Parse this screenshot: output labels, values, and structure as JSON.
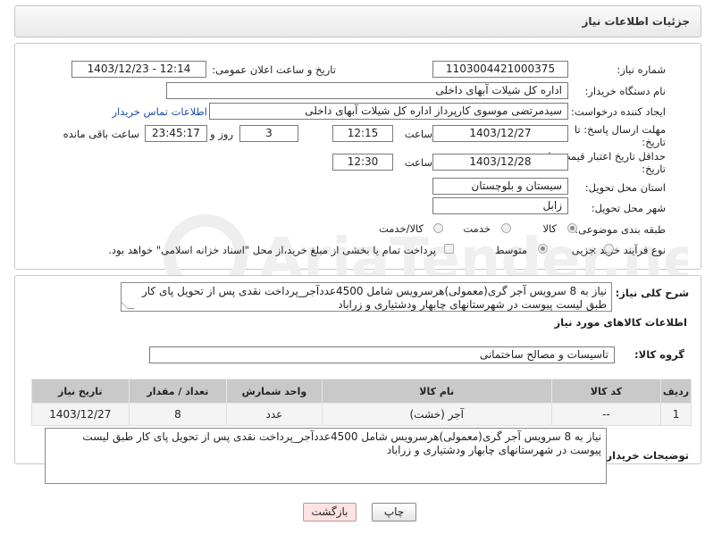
{
  "header": {
    "title": "جزئیات اطلاعات نیاز"
  },
  "fields": {
    "need_number_label": "شماره نیاز:",
    "need_number": "1103004421000375",
    "announce_label": "تاریخ و ساعت اعلان عمومی:",
    "announce_value": "1403/12/23 - 12:14",
    "buyer_org_label": "نام دستگاه خریدار:",
    "buyer_org": "اداره کل شیلات آبهای داخلی",
    "requester_label": "ایجاد کننده درخواست:",
    "requester": "سیدمرتضی موسوی کارپرداز اداره کل شیلات آبهای داخلی",
    "contact_link": "اطلاعات تماس خریدار",
    "deadline_label_1": "مهلت ارسال پاسخ: تا",
    "deadline_label_2": "تاریخ:",
    "deadline_date": "1403/12/27",
    "time_label": "ساعت",
    "deadline_time": "12:15",
    "days_count": "3",
    "days_label": "روز و",
    "remaining_time": "23:45:17",
    "remaining_label": "ساعت باقی مانده",
    "validity_label_1": "حداقل تاریخ اعتبار قیمت: تا",
    "validity_label_2": "تاریخ:",
    "validity_date": "1403/12/28",
    "validity_time_label": "ساعت",
    "validity_time": "12:30",
    "province_label": "استان محل تحویل:",
    "province": "سیستان و بلوچستان",
    "city_label": "شهر محل تحویل:",
    "city": "زابل",
    "category_label": "طبقه بندی موضوعی:",
    "category_options": [
      "کالا",
      "خدمت",
      "کالا/خدمت"
    ],
    "purchase_type_label": "نوع فرآیند خرید :",
    "purchase_options": [
      "جزیی",
      "متوسط"
    ],
    "treasury_note": "پرداخت تمام یا بخشی از مبلغ خرید،از محل \"اسناد خزانه اسلامی\" خواهد بود."
  },
  "description": {
    "label": "شرح کلی نیاز:",
    "text": "نیاز به 8 سرویس آجر گری(معمولی)هرسرویس شامل 4500عددآجر_پرداخت نقدی پس از تحویل پای کار طبق لیست پیوست در  شهرستانهای چابهار ودشتیاری و زراباد"
  },
  "goods_section": {
    "title": "اطلاعات کالاهای مورد نیاز",
    "group_label": "گروه کالا:",
    "group_value": "تاسیسات و مصالح ساختمانی"
  },
  "table": {
    "headers": [
      "ردیف",
      "کد کالا",
      "نام کالا",
      "واحد شمارش",
      "تعداد / مقدار",
      "تاریخ نیاز"
    ],
    "rows": [
      [
        "1",
        "--",
        "آجر (خشت)",
        "عدد",
        "8",
        "1403/12/27"
      ]
    ]
  },
  "buyer_notes": {
    "label": "توضیحات خریدار:",
    "text": "نیاز به 8 سرویس آجر گری(معمولی)هرسرویس شامل 4500عددآجر_پرداخت نقدی پس از تحویل پای کار طبق لیست پیوست در  شهرستانهای چابهار ودشتیاری و زراباد"
  },
  "buttons": {
    "print": "چاپ",
    "back": "بازگشت"
  },
  "watermark": {
    "text": "AriaTender.net"
  }
}
